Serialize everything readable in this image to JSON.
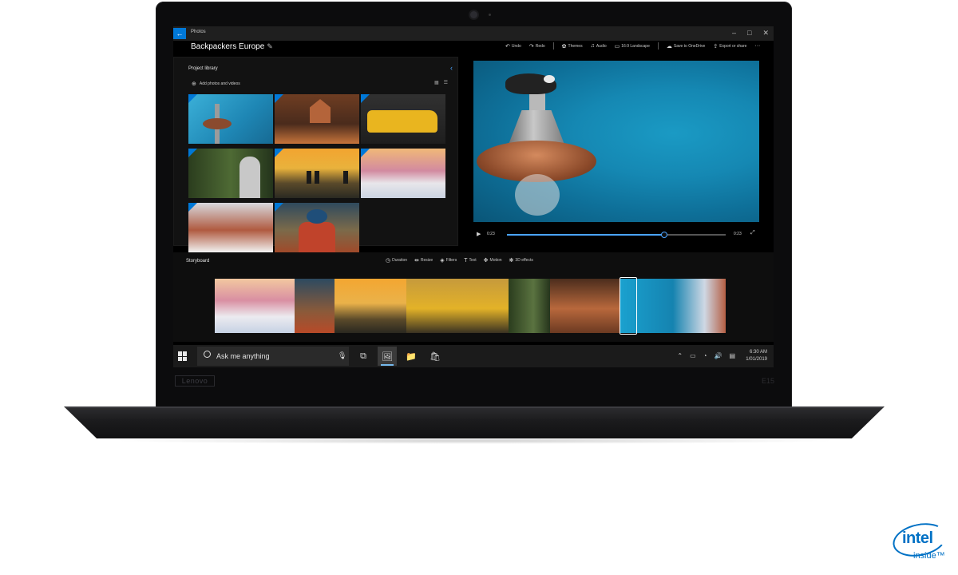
{
  "app": {
    "name": "Photos",
    "project_title": "Backpackers Europe",
    "window_controls": [
      "–",
      "□",
      "✕"
    ]
  },
  "toolbar": {
    "items": [
      {
        "icon": "undo-icon",
        "glyph": "↶",
        "label": "Undo"
      },
      {
        "icon": "redo-icon",
        "glyph": "↷",
        "label": "Redo"
      },
      {
        "icon": "themes-icon",
        "glyph": "✿",
        "label": "Themes"
      },
      {
        "icon": "audio-icon",
        "glyph": "♫",
        "label": "Audio"
      },
      {
        "icon": "aspect-ratio-icon",
        "glyph": "▭",
        "label": "16:9 Landscape"
      },
      {
        "icon": "cloud-icon",
        "glyph": "☁",
        "label": "Save to OneDrive"
      },
      {
        "icon": "export-icon",
        "glyph": "⇪",
        "label": "Export or share"
      }
    ],
    "more_glyph": "···"
  },
  "library": {
    "title": "Project library",
    "add_label": "Add photos and videos",
    "collapse_glyph": "‹"
  },
  "preview": {
    "current_time": "0:23",
    "total_time": "0:23",
    "progress": 0.72
  },
  "storyboard": {
    "title": "Storyboard",
    "tools": [
      {
        "icon": "duration-icon",
        "glyph": "◷",
        "label": "Duration"
      },
      {
        "icon": "resize-icon",
        "glyph": "⇹",
        "label": "Resize"
      },
      {
        "icon": "filters-icon",
        "glyph": "◈",
        "label": "Filters"
      },
      {
        "icon": "text-icon",
        "glyph": "T",
        "label": "Text"
      },
      {
        "icon": "motion-icon",
        "glyph": "✥",
        "label": "Motion"
      },
      {
        "icon": "3d-effects-icon",
        "glyph": "❋",
        "label": "3D effects"
      }
    ]
  },
  "taskbar": {
    "search_placeholder": "Ask me anything",
    "time": "6:30 AM",
    "date": "1/01/2019"
  },
  "hardware": {
    "bezel_brand": "Lenovo",
    "bezel_model": "E15"
  },
  "badge": {
    "word": "intel",
    "sub": "inside™",
    "color": "#0071c5"
  },
  "colors": {
    "accent": "#0078d7",
    "progress": "#4aa3ff"
  }
}
